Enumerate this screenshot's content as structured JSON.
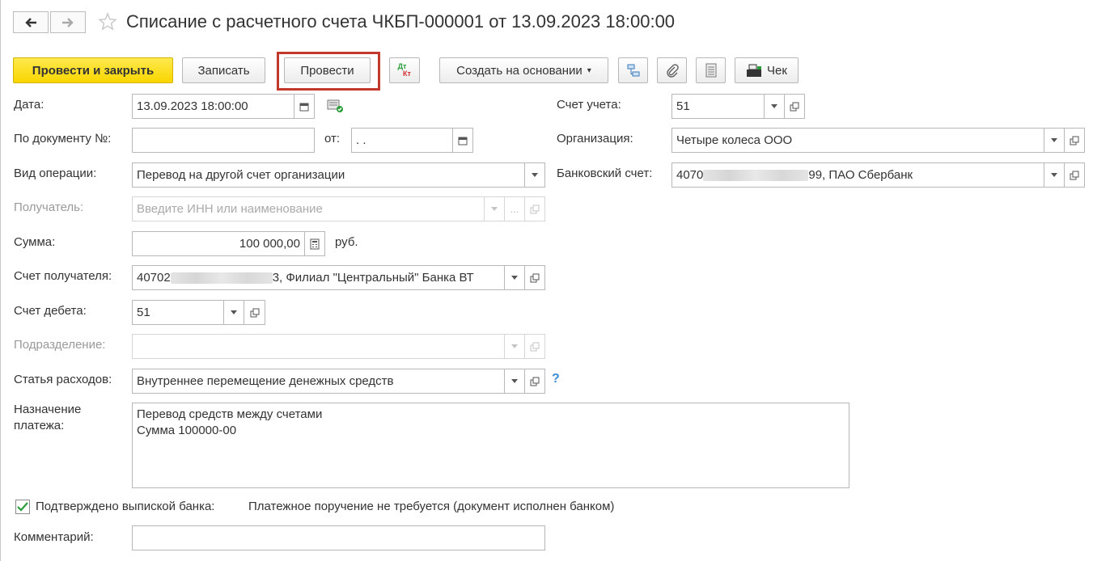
{
  "header": {
    "title": "Списание с расчетного счета ЧКБП-000001 от 13.09.2023 18:00:00"
  },
  "toolbar": {
    "post_close": "Провести и закрыть",
    "save": "Записать",
    "post": "Провести",
    "dt_kt_top": "Дт",
    "dt_kt_bottom": "Кт",
    "create_based": "Создать на основании",
    "check": "Чек"
  },
  "form": {
    "date": {
      "label": "Дата:",
      "value": "13.09.2023 18:00:00"
    },
    "doc_num": {
      "label": "По документу №:",
      "value": "",
      "from_label": "от:",
      "from_value": " .  ."
    },
    "op_type": {
      "label": "Вид операции:",
      "value": "Перевод на другой счет организации"
    },
    "recipient": {
      "label": "Получатель:",
      "placeholder": "Введите ИНН или наименование",
      "dots": "..."
    },
    "amount": {
      "label": "Сумма:",
      "value": "100 000,00",
      "currency": "руб."
    },
    "recipient_account": {
      "label": "Счет получателя:",
      "prefix": "40702",
      "suffix": "3, Филиал \"Центральный\" Банка ВТ"
    },
    "debit_account": {
      "label": "Счет дебета:",
      "value": "51"
    },
    "division": {
      "label": "Подразделение:",
      "value": ""
    },
    "expense_item": {
      "label": "Статья расходов:",
      "value": "Внутреннее перемещение денежных средств",
      "help": "?"
    },
    "purpose": {
      "label_line1": "Назначение",
      "label_line2": "платежа:",
      "value": "Перевод средств между счетами\nСумма 100000-00"
    },
    "confirmed": {
      "label": "Подтверждено выпиской банка:",
      "checked": true,
      "note": "Платежное поручение не требуется (документ исполнен банком)"
    },
    "comment": {
      "label": "Комментарий:",
      "value": ""
    },
    "account": {
      "label": "Счет учета:",
      "value": "51"
    },
    "organization": {
      "label": "Организация:",
      "value": "Четыре колеса ООО"
    },
    "bank_account": {
      "label": "Банковский счет:",
      "prefix": "4070",
      "suffix": "99, ПАО Сбербанк"
    }
  },
  "colors": {
    "accent_yellow": "#f9d600",
    "highlight_red": "#c0392b",
    "help_blue": "#3b8dd8"
  }
}
